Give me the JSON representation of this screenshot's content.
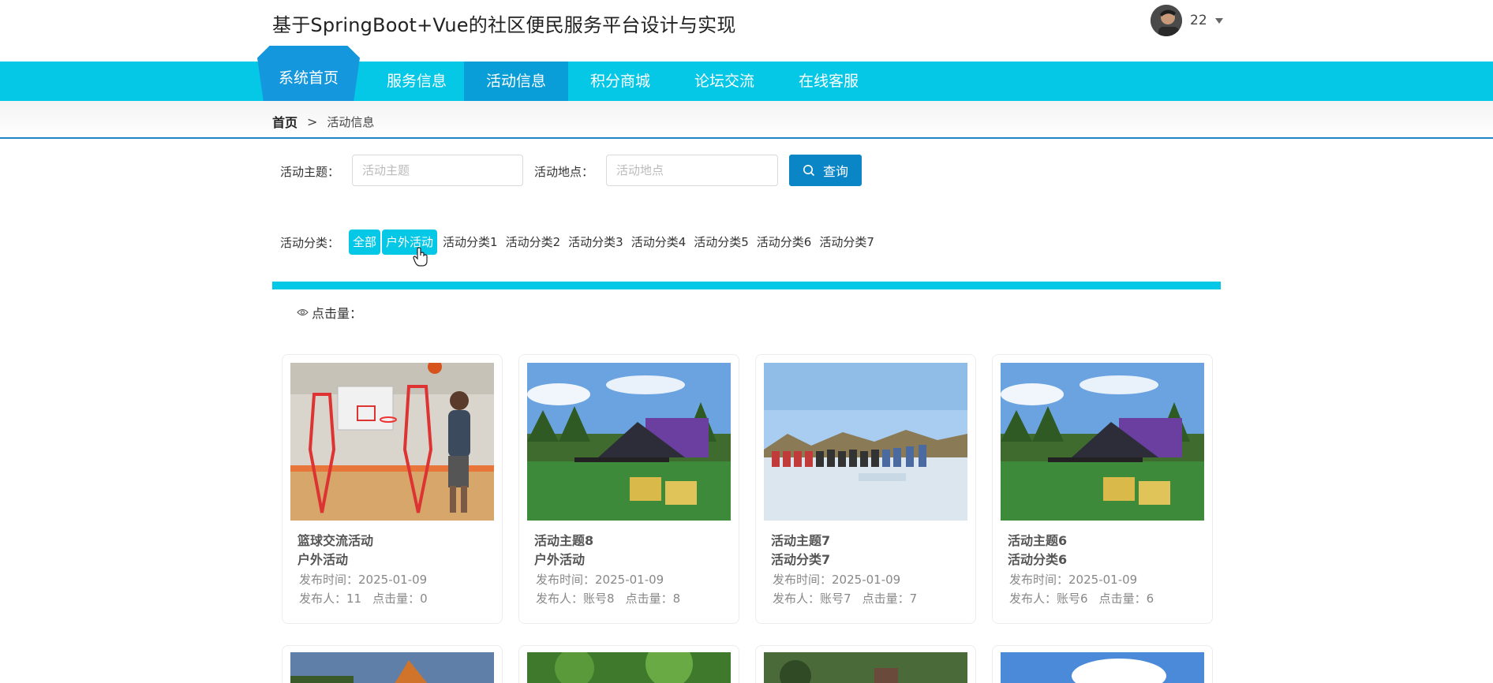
{
  "header": {
    "site_title": "基于SpringBoot+Vue的社区便民服务平台设计与实现",
    "user_name": "22"
  },
  "nav": {
    "home": "系统首页",
    "items": [
      "服务信息",
      "活动信息",
      "积分商城",
      "论坛交流",
      "在线客服"
    ],
    "active_index": 1
  },
  "breadcrumb": {
    "home": "首页",
    "separator": ">",
    "current": "活动信息"
  },
  "search": {
    "theme_label": "活动主题：",
    "theme_placeholder": "活动主题",
    "place_label": "活动地点：",
    "place_placeholder": "活动地点",
    "button_label": "查询"
  },
  "categories": {
    "label": "活动分类：",
    "items": [
      "全部",
      "户外活动",
      "活动分类1",
      "活动分类2",
      "活动分类3",
      "活动分类4",
      "活动分类5",
      "活动分类6",
      "活动分类7"
    ],
    "selected": [
      "全部",
      "户外活动"
    ]
  },
  "sort": {
    "label": "点击量："
  },
  "cards": [
    {
      "title": "篮球交流活动",
      "category": "户外活动",
      "date_label": "发布时间：",
      "date": "2025-01-09",
      "author_label": "发布人：",
      "author": "11",
      "clicks_label": "点击量：",
      "clicks": "0"
    },
    {
      "title": "活动主题8",
      "category": "户外活动",
      "date_label": "发布时间：",
      "date": "2025-01-09",
      "author_label": "发布人：",
      "author": "账号8",
      "clicks_label": "点击量：",
      "clicks": "8"
    },
    {
      "title": "活动主题7",
      "category": "活动分类7",
      "date_label": "发布时间：",
      "date": "2025-01-09",
      "author_label": "发布人：",
      "author": "账号7",
      "clicks_label": "点击量：",
      "clicks": "7"
    },
    {
      "title": "活动主题6",
      "category": "活动分类6",
      "date_label": "发布时间：",
      "date": "2025-01-09",
      "author_label": "发布人：",
      "author": "账号6",
      "clicks_label": "点击量：",
      "clicks": "6"
    }
  ],
  "colors": {
    "nav_bg": "#05c7e6",
    "nav_active": "#0a9ed8",
    "home_tab": "#1597de",
    "search_button": "#0a86c6",
    "divider": "#05c7e6"
  }
}
